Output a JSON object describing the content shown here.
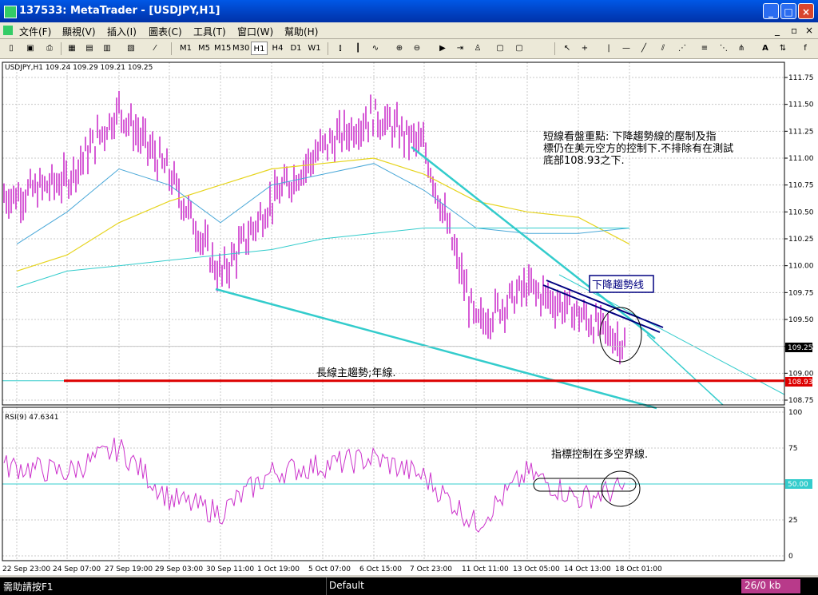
{
  "window": {
    "title": "137533: MetaTrader - [USDJPY,H1]",
    "buttons": [
      "_",
      "□",
      "×"
    ]
  },
  "menu": [
    "文件(F)",
    "顯視(V)",
    "插入(I)",
    "圖表(C)",
    "工具(T)",
    "窗口(W)",
    "幫助(H)"
  ],
  "toolbar": {
    "timeframes": [
      "M1",
      "M5",
      "M15",
      "M30",
      "H1",
      "H4",
      "D1",
      "W1"
    ],
    "active_timeframe": "H1"
  },
  "chart": {
    "info_label": "USDJPY,H1  109.24 109.29 109.21 109.25",
    "price_axis": [
      "111.75",
      "111.50",
      "111.25",
      "111.00",
      "110.75",
      "110.50",
      "110.25",
      "110.00",
      "109.75",
      "109.50",
      "109.25",
      "109.00",
      "108.75"
    ],
    "current_price": "109.25",
    "support_price": "108.93",
    "time_axis": [
      "22 Sep 23:00",
      "24 Sep 07:00",
      "27 Sep 19:00",
      "29 Sep 03:00",
      "30 Sep 11:00",
      "1 Oct 19:00",
      "5 Oct 07:00",
      "6 Oct 15:00",
      "7 Oct 23:00",
      "11 Oct 11:00",
      "13 Oct 05:00",
      "14 Oct 13:00",
      "18 Oct 01:00"
    ],
    "annotations": {
      "short_term": [
        "短線看盤重點: 下降趨勢線的壓制及指",
        "標仍在美元空方的控制下.不排除有在測試",
        "底部108.93之下."
      ],
      "downtrend_label": "下降趨勢线",
      "long_term_label": "長線主趨勢;年線.",
      "rsi_note": "指標控制在多空界線."
    },
    "colors": {
      "candles": "#cc33cc",
      "trendlines": "#33cccc",
      "downtrend_line": "#000080",
      "support_line": "#dd0000",
      "ma_yellow": "#e6d41e",
      "ma_blue": "#4aa8d8",
      "rsi_line": "#cc33cc"
    }
  },
  "rsi": {
    "label": "RSI(9)  47.6341",
    "axis": [
      "100",
      "75",
      "50",
      "25",
      "0"
    ],
    "current_marker": "50.00"
  },
  "status": {
    "help": "需助請按F1",
    "profile": "Default",
    "traffic": "26/0 kb"
  },
  "chart_data": {
    "type": "line",
    "title": "USDJPY,H1",
    "xlabel": "",
    "ylabel": "",
    "ylim": [
      108.75,
      111.75
    ],
    "x": [
      "22 Sep 23:00",
      "24 Sep 07:00",
      "27 Sep 19:00",
      "29 Sep 03:00",
      "30 Sep 11:00",
      "1 Oct 19:00",
      "5 Oct 07:00",
      "6 Oct 15:00",
      "7 Oct 23:00",
      "11 Oct 11:00",
      "13 Oct 05:00",
      "14 Oct 13:00",
      "18 Oct 01:00"
    ],
    "series": [
      {
        "name": "",
        "values": [
          110.65,
          110.8,
          111.45,
          110.85,
          109.9,
          110.6,
          111.1,
          111.4,
          111.1,
          109.45,
          109.8,
          109.55,
          109.25
        ]
      },
      {
        "name": "RSI(9)",
        "values": [
          62,
          58,
          75,
          40,
          30,
          58,
          63,
          68,
          55,
          22,
          58,
          40,
          47.6341
        ]
      }
    ]
  }
}
